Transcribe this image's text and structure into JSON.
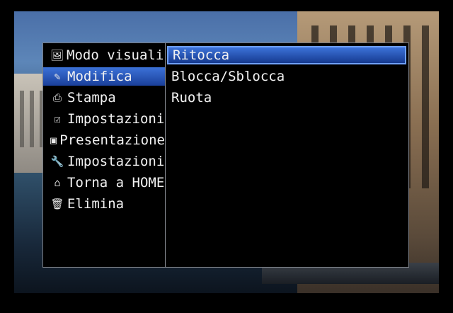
{
  "menu": {
    "items": [
      {
        "icon": "image-view-icon",
        "glyph": "🖼",
        "label": "Modo visualizzazione"
      },
      {
        "icon": "pencil-icon",
        "glyph": "✎",
        "label": "Modifica"
      },
      {
        "icon": "printer-icon",
        "glyph": "⎙",
        "label": "Stampa"
      },
      {
        "icon": "checkbox-icon",
        "glyph": "☑",
        "label": "Impostazioni"
      },
      {
        "icon": "slideshow-icon",
        "glyph": "▣",
        "label": "Presentazione"
      },
      {
        "icon": "wrench-icon",
        "glyph": "🔧",
        "label": "Impostazioni"
      },
      {
        "icon": "home-icon",
        "glyph": "⌂",
        "label": "Torna a HOME"
      },
      {
        "icon": "trash-icon",
        "glyph": "🗑",
        "label": "Elimina"
      }
    ],
    "selected_index": 1,
    "submenu": [
      "Ritocca",
      "Blocca/Sblocca",
      "Ruota"
    ],
    "submenu_selected_index": 0
  }
}
